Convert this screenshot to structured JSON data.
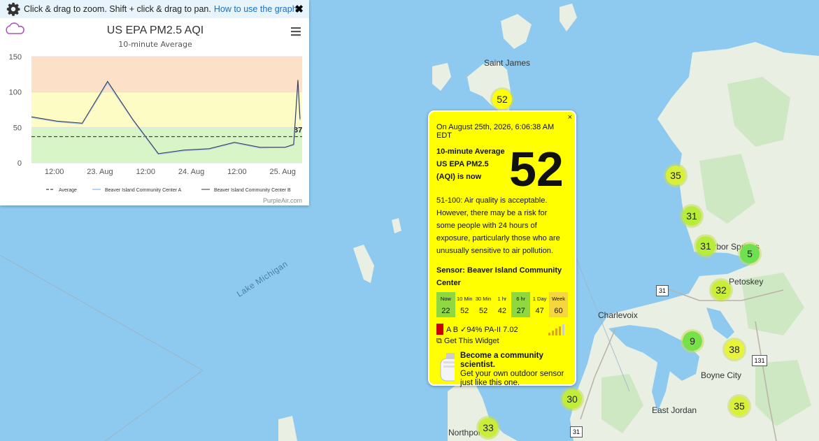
{
  "graph": {
    "toolbar_text": "Click & drag to zoom. Shift + click & drag to pan.",
    "help_link": "How to use the graph.",
    "close_label": "✖",
    "footer_credit": "PurpleAir.com"
  },
  "chart_data": {
    "type": "line",
    "title": "US EPA PM2.5 AQI",
    "subtitle": "10-minute Average",
    "ylim": [
      0,
      150
    ],
    "y_ticks": [
      0,
      50,
      100,
      150
    ],
    "x_tick_labels": [
      "12:00",
      "23. Aug",
      "12:00",
      "24. Aug",
      "12:00",
      "25. Aug"
    ],
    "x_hours": [
      0,
      6,
      12,
      18,
      24,
      30,
      36,
      42,
      48,
      54,
      60,
      62,
      63,
      63.5
    ],
    "series": [
      {
        "name": "Beaver Island Community Center A",
        "values": [
          64,
          58,
          55,
          113,
          60,
          12,
          17,
          19,
          28,
          21,
          22,
          25,
          115,
          60
        ]
      },
      {
        "name": "Beaver Island Community Center B",
        "values": [
          65,
          59,
          56,
          115,
          61,
          13,
          18,
          20,
          29,
          22,
          22,
          26,
          117,
          62
        ]
      }
    ],
    "average_label": "Average",
    "average_value": 37,
    "average_data_label": "37",
    "bands": [
      {
        "from": 0,
        "to": 50,
        "color": "#d8f5c8"
      },
      {
        "from": 50,
        "to": 100,
        "color": "#fdfcc4"
      },
      {
        "from": 100,
        "to": 150,
        "color": "#fde0c8"
      }
    ],
    "legend_position": "bottom",
    "colors": {
      "average": "#444444",
      "series_a": "#a9c9ee",
      "series_b": "#333344"
    }
  },
  "popup": {
    "close_label": "×",
    "date_text": "On August 25th, 2026, 6:06:38 AM EDT",
    "aqi_label": "10-minute Average US EPA PM2.5 (AQI) is now",
    "aqi_value": "52",
    "description": "51-100: Air quality is acceptable. However, there may be a risk for some people with 24 hours of exposure, particularly those who are unusually sensitive to air pollution.",
    "sensor_text": "Sensor: Beaver Island Community Center",
    "periods": [
      {
        "label": "Now",
        "value": "22",
        "color": "#8fd840"
      },
      {
        "label": "10 Min",
        "value": "52",
        "color": "#ffff00"
      },
      {
        "label": "30 Min",
        "value": "52",
        "color": "#ffff00"
      },
      {
        "label": "1 hr",
        "value": "42",
        "color": "#ffff00"
      },
      {
        "label": "6 hr",
        "value": "27",
        "color": "#8fd840"
      },
      {
        "label": "1 Day",
        "value": "47",
        "color": "#ffff00"
      },
      {
        "label": "Week",
        "value": "60",
        "color": "#f5d640"
      }
    ],
    "channel_info": "A B ✓94% PA-II 7.02",
    "widget_link": "Get This Widget",
    "promo_title": "Become a community scientist.",
    "promo_text": "Get your own outdoor sensor just like this one."
  },
  "map": {
    "places": [
      {
        "name": "Saint James"
      },
      {
        "name": "Harbor Springs"
      },
      {
        "name": "Petoskey"
      },
      {
        "name": "Charlevoix"
      },
      {
        "name": "Boyne City"
      },
      {
        "name": "East Jordan"
      },
      {
        "name": "Northport"
      }
    ],
    "lake_label": "Lake Michigan",
    "highway_labels": [
      "31",
      "131",
      "31"
    ],
    "markers": [
      {
        "value": "52",
        "color": "#ffff00"
      },
      {
        "value": "35",
        "color": "#d8f03a"
      },
      {
        "value": "31",
        "color": "#b8ec3a"
      },
      {
        "value": "31",
        "color": "#b8ec3a"
      },
      {
        "value": "5",
        "color": "#6fe050"
      },
      {
        "value": "32",
        "color": "#c8ee3a"
      },
      {
        "value": "9",
        "color": "#78e048"
      },
      {
        "value": "38",
        "color": "#e8f43a"
      },
      {
        "value": "35",
        "color": "#d8f03a"
      },
      {
        "value": "30",
        "color": "#c0ec3a"
      },
      {
        "value": "33",
        "color": "#c8ee3a"
      }
    ]
  }
}
